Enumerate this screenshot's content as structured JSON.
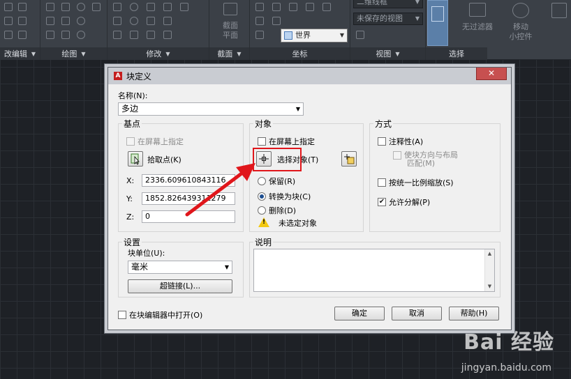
{
  "ribbon": {
    "panels": [
      {
        "title": "改编辑"
      },
      {
        "title": "绘图"
      },
      {
        "title": "修改"
      },
      {
        "title": "截面"
      },
      {
        "title": "坐标"
      },
      {
        "title": "视图"
      },
      {
        "title": "选择"
      }
    ],
    "section_plane": "截面\n平面",
    "world": "世界",
    "visual_style": "二维线框",
    "unsaved_view": "未保存的视图",
    "no_filter": "无过滤器",
    "move_gizmo": "移动\n小控件"
  },
  "dialog": {
    "title": "块定义",
    "close": "✕",
    "name_label": "名称(N):",
    "name_value": "多边",
    "base_point": {
      "title": "基点",
      "specify_on_screen": "在屏幕上指定",
      "pick_point": "拾取点(K)",
      "x_label": "X:",
      "x_value": "2336.609610843116",
      "y_label": "Y:",
      "y_value": "1852.826439311279",
      "z_label": "Z:",
      "z_value": "0"
    },
    "objects": {
      "title": "对象",
      "specify_on_screen": "在屏幕上指定",
      "select_objects": "选择对象(T)",
      "retain": "保留(R)",
      "convert_to_block": "转换为块(C)",
      "delete": "删除(D)",
      "status": "未选定对象"
    },
    "behavior": {
      "title": "方式",
      "annotative": "注释性(A)",
      "match_orientation_1": "使块方向与布局",
      "match_orientation_2": "匹配(M)",
      "scale_uniformly": "按统一比例缩放(S)",
      "allow_exploding": "允许分解(P)"
    },
    "settings": {
      "title": "设置",
      "block_unit_label": "块单位(U):",
      "block_unit_value": "毫米",
      "hyperlink": "超链接(L)..."
    },
    "description": {
      "title": "说明"
    },
    "open_in_editor": "在块编辑器中打开(O)",
    "ok": "确定",
    "cancel": "取消",
    "help": "帮助(H)"
  },
  "watermark": {
    "main": "Bai 经验",
    "sub": "jingyan.baidu.com"
  }
}
